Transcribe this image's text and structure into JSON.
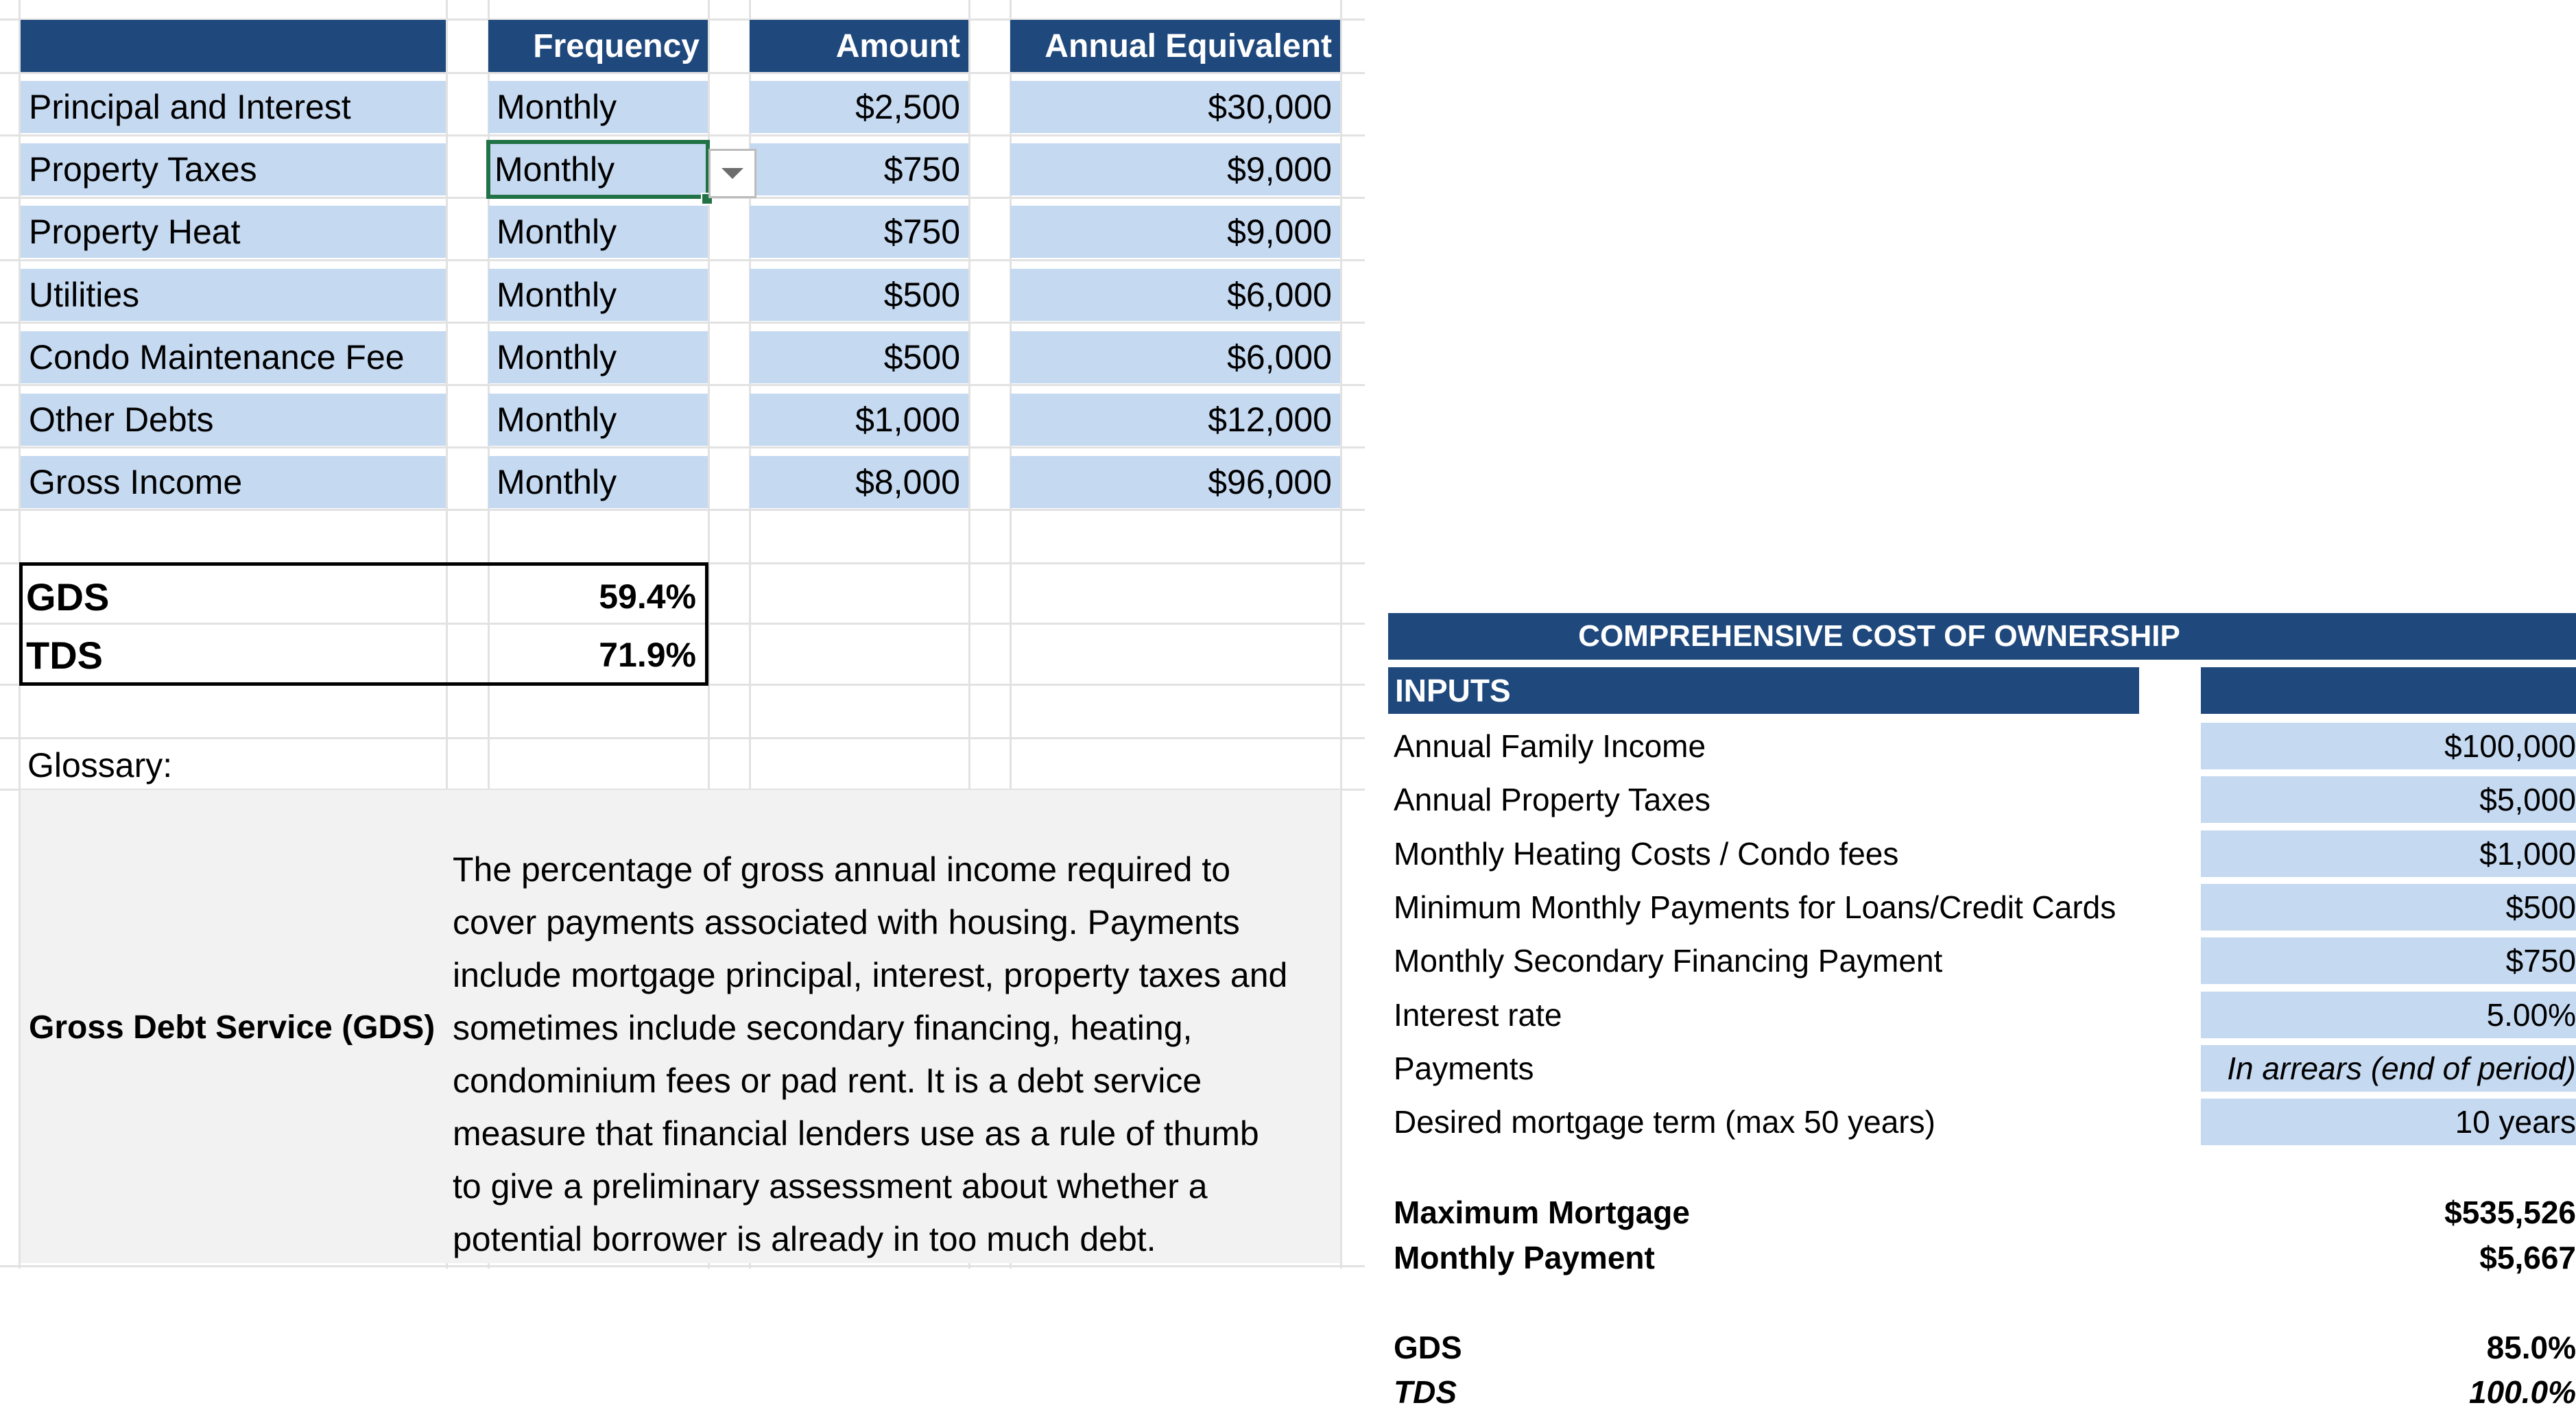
{
  "left_table": {
    "headers": [
      "",
      "Frequency",
      "Amount",
      "Annual Equivalent"
    ],
    "rows": [
      {
        "label": "Principal and Interest",
        "frequency": "Monthly",
        "amount": "$2,500",
        "annual": "$30,000"
      },
      {
        "label": "Property Taxes",
        "frequency": "Monthly",
        "amount": "$750",
        "annual": "$9,000"
      },
      {
        "label": "Property Heat",
        "frequency": "Monthly",
        "amount": "$750",
        "annual": "$9,000"
      },
      {
        "label": "Utilities",
        "frequency": "Monthly",
        "amount": "$500",
        "annual": "$6,000"
      },
      {
        "label": "Condo Maintenance Fee",
        "frequency": "Monthly",
        "amount": "$500",
        "annual": "$6,000"
      },
      {
        "label": "Other Debts",
        "frequency": "Monthly",
        "amount": "$1,000",
        "annual": "$12,000"
      },
      {
        "label": "Gross Income",
        "frequency": "Monthly",
        "amount": "$8,000",
        "annual": "$96,000"
      }
    ],
    "selected_cell": {
      "row": 1,
      "column": "Frequency",
      "dropdown_icon": "chevron-down-icon"
    }
  },
  "ratios": [
    {
      "label": "GDS",
      "value": "59.4%"
    },
    {
      "label": "TDS",
      "value": "71.9%"
    }
  ],
  "glossary": {
    "label": "Glossary:",
    "term": "Gross Debt Service (GDS)",
    "definition_lines": [
      "The percentage of gross annual income required to",
      "cover payments associated with housing. Payments",
      "include mortgage principal, interest, property taxes and",
      "sometimes include secondary financing, heating,",
      "condominium fees or pad rent. It is a debt service",
      "measure that financial lenders use as a rule of thumb",
      "to give a preliminary assessment about whether a",
      "potential borrower is already in too much debt."
    ]
  },
  "ownership": {
    "title": "COMPREHENSIVE COST OF OWNERSHIP",
    "inputs_header": "INPUTS",
    "inputs": [
      {
        "label": "Annual Family Income",
        "value": "$100,000"
      },
      {
        "label": "Annual Property Taxes",
        "value": "$5,000"
      },
      {
        "label": "Monthly Heating Costs / Condo fees",
        "value": "$1,000"
      },
      {
        "label": "Minimum Monthly Payments for Loans/Credit Cards",
        "value": "$500"
      },
      {
        "label": "Monthly Secondary Financing Payment",
        "value": "$750"
      },
      {
        "label": "Interest rate",
        "value": "5.00%"
      },
      {
        "label": "Payments",
        "value": "In arrears (end of period)"
      },
      {
        "label": "Desired mortgage term (max 50 years)",
        "value": "10 years"
      }
    ],
    "results": [
      {
        "label": "Maximum Mortgage",
        "value": "$535,526"
      },
      {
        "label": "Monthly Payment",
        "value": "$5,667"
      }
    ],
    "ratios": [
      {
        "label": "GDS",
        "value": "85.0%"
      },
      {
        "label": "TDS",
        "value": "100.0%"
      }
    ]
  },
  "colors": {
    "header_bg": "#1f497d",
    "input_cell_bg": "#c5d9f1",
    "selection": "#217346",
    "glossary_bg": "#f2f2f2"
  }
}
